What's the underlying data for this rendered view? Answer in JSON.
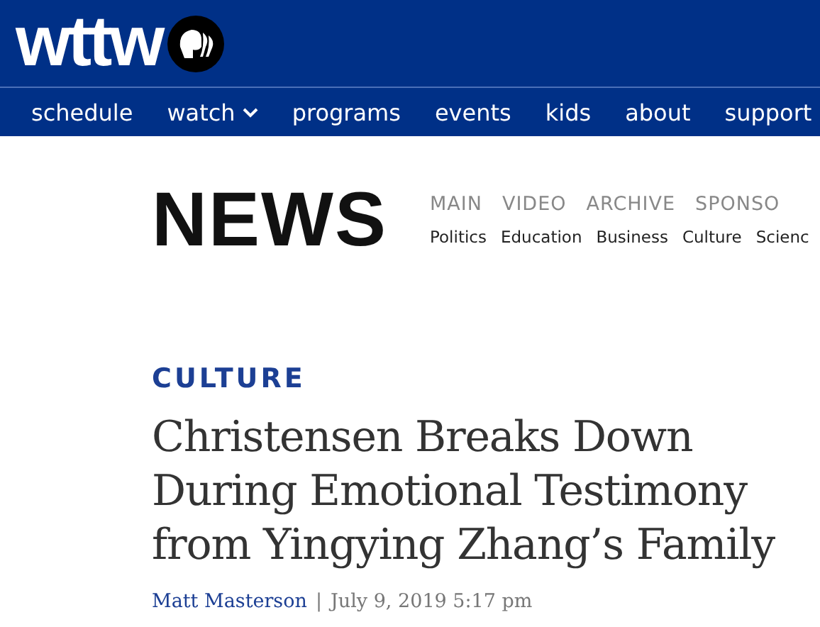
{
  "header": {
    "logo": "wttw"
  },
  "nav": [
    {
      "label": "schedule",
      "dropdown": false
    },
    {
      "label": "watch",
      "dropdown": true
    },
    {
      "label": "programs",
      "dropdown": false
    },
    {
      "label": "events",
      "dropdown": false
    },
    {
      "label": "kids",
      "dropdown": false
    },
    {
      "label": "about",
      "dropdown": false
    },
    {
      "label": "support",
      "dropdown": false
    }
  ],
  "news": {
    "title": "NEWS",
    "main_menu": [
      "MAIN",
      "VIDEO",
      "ARCHIVE",
      "SPONSO"
    ],
    "sub_menu": [
      "Politics",
      "Education",
      "Business",
      "Culture",
      "Scienc"
    ]
  },
  "article": {
    "category": "CULTURE",
    "headline": "Christensen Breaks Down During Emotional Testimony from Yingying Zhang’s Family",
    "author": "Matt Masterson",
    "separator": "|",
    "date": "July 9, 2019 5:17 pm"
  }
}
